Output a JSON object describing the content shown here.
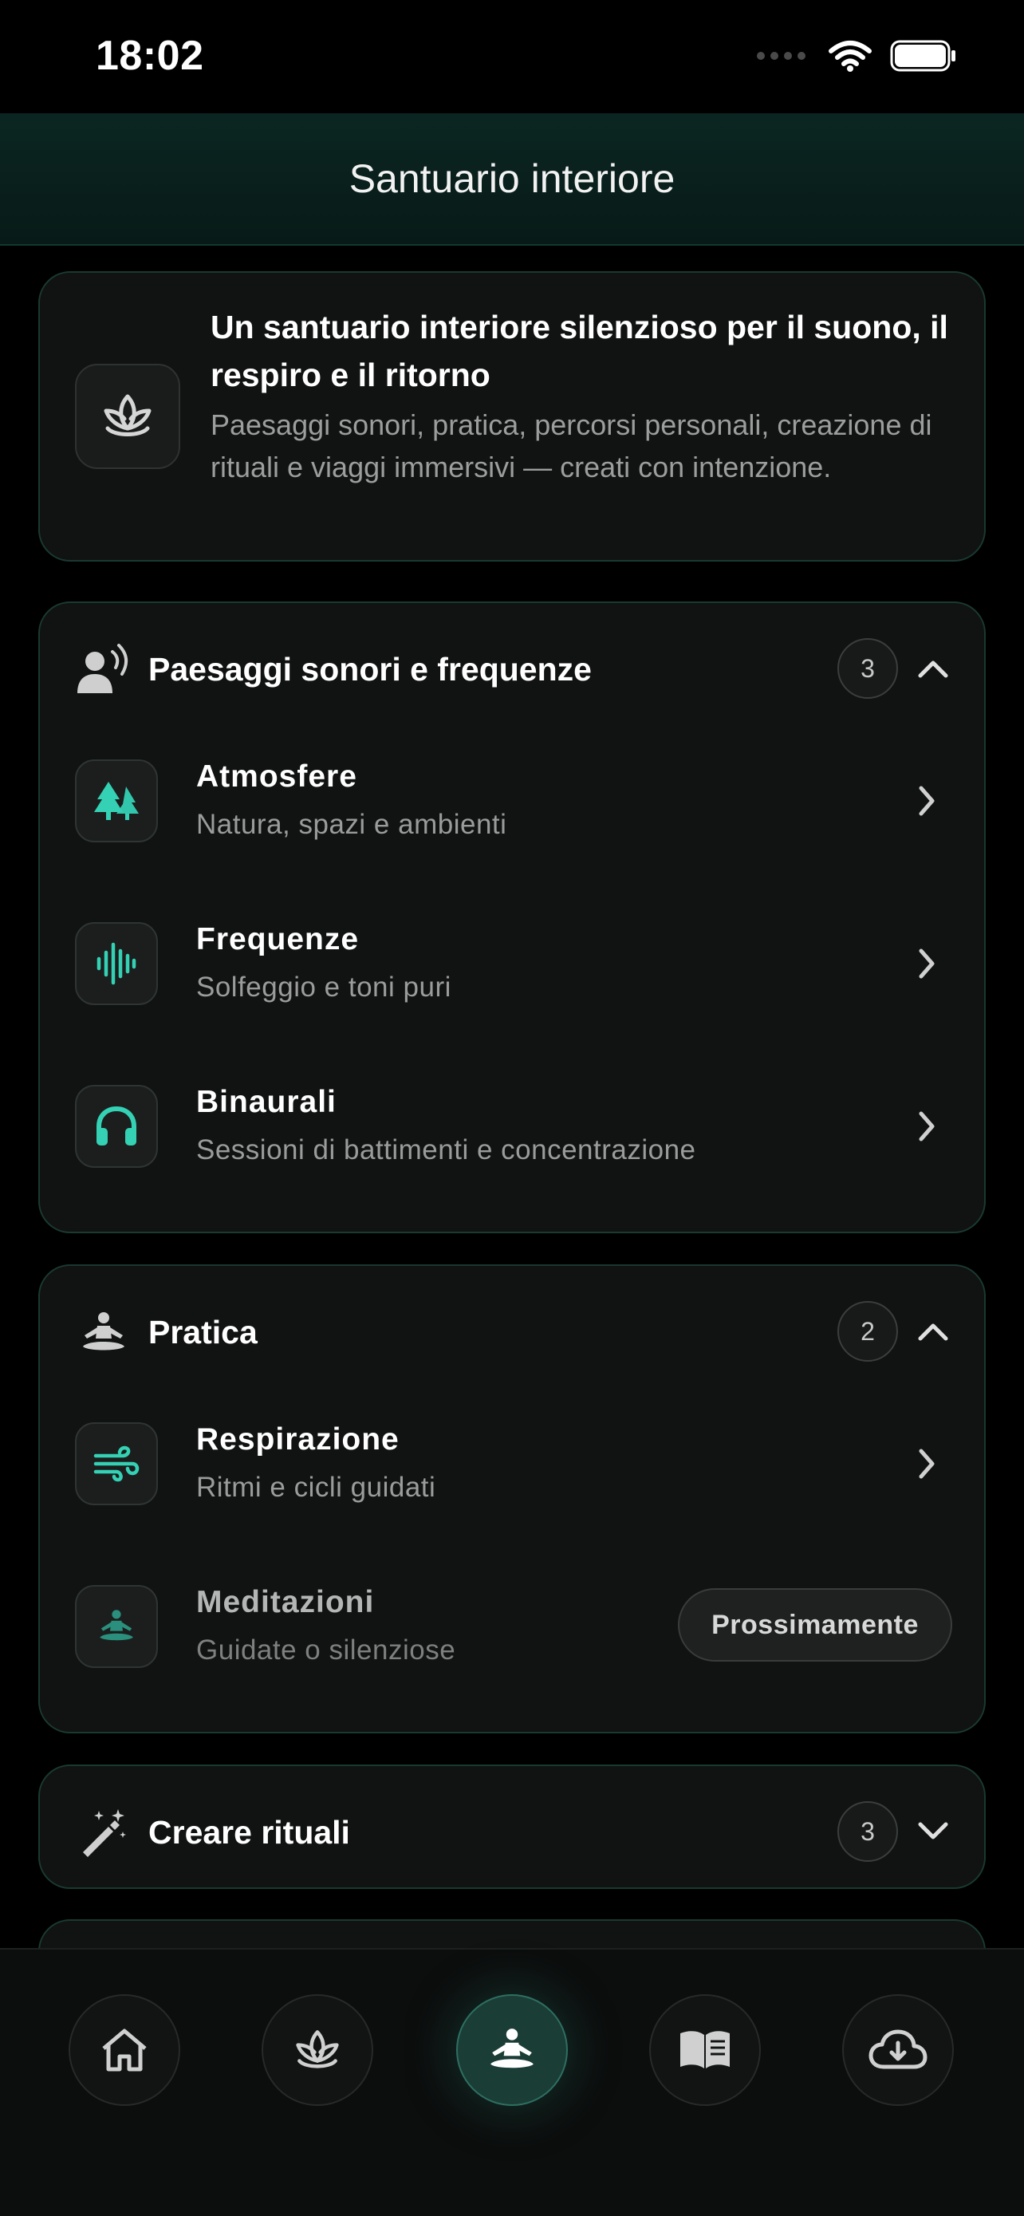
{
  "status": {
    "time": "18:02"
  },
  "header": {
    "title": "Santuario interiore"
  },
  "intro": {
    "title": "Un santuario interiore silenzioso per il suono, il respiro e il ritorno",
    "text": "Paesaggi sonori, pratica, percorsi personali, creazione di rituali e viaggi immersivi — creati con intenzione.",
    "icon": "lotus-icon"
  },
  "sections": {
    "sound": {
      "title": "Paesaggi sonori e frequenze",
      "count": "3",
      "icon": "person-sound-icon",
      "items": [
        {
          "title": "Atmosfere",
          "subtitle": "Natura, spazi e ambienti",
          "icon": "trees-icon"
        },
        {
          "title": "Frequenze",
          "subtitle": "Solfeggio e toni puri",
          "icon": "waveform-icon"
        },
        {
          "title": "Binaurali",
          "subtitle": "Sessioni di battimenti e concentrazione",
          "icon": "headphones-icon"
        }
      ]
    },
    "pratica": {
      "title": "Pratica",
      "count": "2",
      "icon": "meditation-icon",
      "items": [
        {
          "title": "Respirazione",
          "subtitle": "Ritmi e cicli guidati",
          "icon": "wind-icon"
        },
        {
          "title": "Meditazioni",
          "subtitle": "Guidate o silenziose",
          "icon": "meditation-icon",
          "badge": "Prossimamente"
        }
      ]
    },
    "rituali": {
      "title": "Creare rituali",
      "count": "3",
      "icon": "magic-wand-icon"
    }
  },
  "tabbar": {
    "tabs": [
      "home-icon",
      "lotus-icon",
      "meditation-icon",
      "book-icon",
      "cloud-download-icon"
    ],
    "active_index": 2
  },
  "colors": {
    "accent": "#34d1b4",
    "card_border": "#193a31",
    "background": "#000000"
  }
}
